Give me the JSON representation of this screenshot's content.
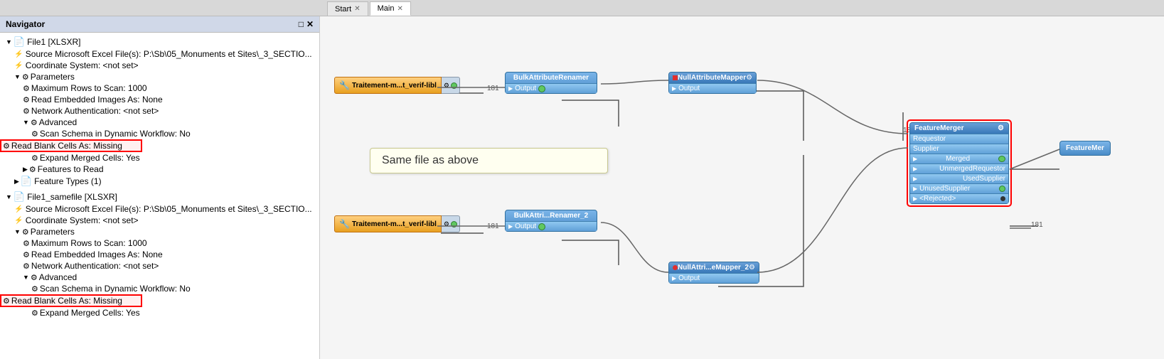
{
  "app": {
    "title": "Navigator"
  },
  "tabs": [
    {
      "id": "start",
      "label": "Start",
      "active": false,
      "closable": true
    },
    {
      "id": "main",
      "label": "Main",
      "active": true,
      "closable": true
    }
  ],
  "navigator": {
    "title": "Navigator",
    "tree": [
      {
        "id": "file1",
        "level": 1,
        "type": "file",
        "label": "File1 [XLSXR]",
        "expanded": true
      },
      {
        "id": "file1-source",
        "level": 2,
        "type": "info",
        "label": "Source Microsoft Excel File(s): P:\\Sb\\05_Monuments et Sites\\_3_SECTIO..."
      },
      {
        "id": "file1-coord",
        "level": 2,
        "type": "info",
        "label": "Coordinate System: <not set>"
      },
      {
        "id": "file1-params",
        "level": 2,
        "type": "params",
        "label": "Parameters",
        "expanded": true
      },
      {
        "id": "file1-maxrows",
        "level": 3,
        "type": "setting",
        "label": "Maximum Rows to Scan: 1000"
      },
      {
        "id": "file1-images",
        "level": 3,
        "type": "setting",
        "label": "Read Embedded Images As: None"
      },
      {
        "id": "file1-network",
        "level": 3,
        "type": "setting",
        "label": "Network Authentication: <not set>"
      },
      {
        "id": "file1-advanced",
        "level": 3,
        "type": "params",
        "label": "Advanced",
        "expanded": true
      },
      {
        "id": "file1-scan",
        "level": 4,
        "type": "setting",
        "label": "Scan Schema in Dynamic Workflow: No"
      },
      {
        "id": "file1-blank",
        "level": 4,
        "type": "setting-highlight",
        "label": "Read Blank Cells As: Missing"
      },
      {
        "id": "file1-merged",
        "level": 4,
        "type": "setting",
        "label": "Expand Merged Cells: Yes"
      },
      {
        "id": "file1-features",
        "level": 3,
        "type": "params",
        "label": "Features to Read"
      },
      {
        "id": "file1-types",
        "level": 2,
        "type": "feature-types",
        "label": "Feature Types (1)"
      },
      {
        "id": "file1-samefile",
        "level": 1,
        "type": "file",
        "label": "File1_samefile [XLSXR]",
        "expanded": true
      },
      {
        "id": "sf-source",
        "level": 2,
        "type": "info",
        "label": "Source Microsoft Excel File(s): P:\\Sb\\05_Monuments et Sites\\_3_SECTIO..."
      },
      {
        "id": "sf-coord",
        "level": 2,
        "type": "info",
        "label": "Coordinate System: <not set>"
      },
      {
        "id": "sf-params",
        "level": 2,
        "type": "params",
        "label": "Parameters",
        "expanded": true
      },
      {
        "id": "sf-maxrows",
        "level": 3,
        "type": "setting",
        "label": "Maximum Rows to Scan: 1000"
      },
      {
        "id": "sf-images",
        "level": 3,
        "type": "setting",
        "label": "Read Embedded Images As: None"
      },
      {
        "id": "sf-network",
        "level": 3,
        "type": "setting",
        "label": "Network Authentication: <not set>"
      },
      {
        "id": "sf-advanced",
        "level": 3,
        "type": "params",
        "label": "Advanced",
        "expanded": true
      },
      {
        "id": "sf-scan",
        "level": 4,
        "type": "setting",
        "label": "Scan Schema in Dynamic Workflow: No"
      },
      {
        "id": "sf-blank",
        "level": 4,
        "type": "setting-highlight",
        "label": "Read Blank Cells As: Missing"
      },
      {
        "id": "sf-merged",
        "level": 4,
        "type": "setting",
        "label": "Expand Merged Cells: Yes"
      }
    ]
  },
  "canvas": {
    "annotation": "Same file as above",
    "nodes": {
      "traitement_top": "Traitement-m...t_verif-libl",
      "traitement_bot": "Traitement-m...t_verif-libl",
      "bulk_top": "BulkAttributeRenamer",
      "bulk_bot": "BulkAttri...Renamer_2",
      "null_top": "NullAttributeMapper",
      "null_bot": "NullAttri...eMapper_2",
      "feature_merger": "FeatureMerger",
      "feature_mer_out": "FeatureMer",
      "label_181_1": "181",
      "label_181_2": "181",
      "label_181_3": "181",
      "label_181_4": "181",
      "output": "Output",
      "ports": {
        "requestor": "Requestor",
        "supplier": "Supplier",
        "merged": "Merged",
        "unmerged_requestor": "UnmergedRequestor",
        "used_supplier": "UsedSupplier",
        "unused_supplier": "UnusedSupplier",
        "rejected": "<Rejected>"
      }
    }
  }
}
